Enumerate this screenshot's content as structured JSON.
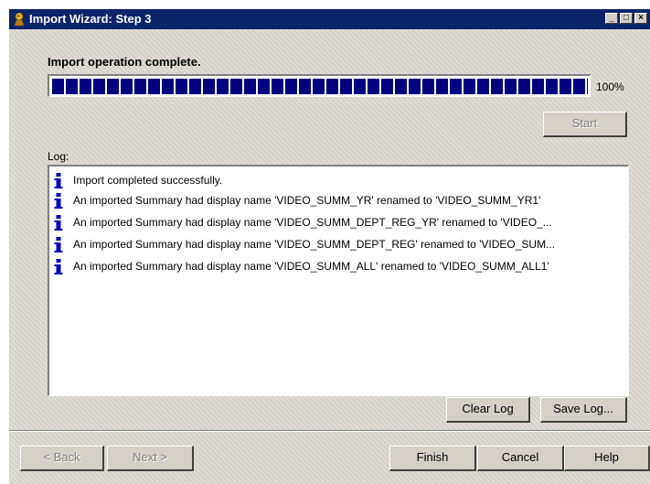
{
  "window": {
    "title": "Import Wizard: Step 3"
  },
  "titlebar": {
    "minimize": "_",
    "maximize": "□",
    "close": "×"
  },
  "progress": {
    "status": "Import operation complete.",
    "percent_label": "100%",
    "value": 1.0
  },
  "buttons": {
    "start": "Start",
    "clear_log": "Clear Log",
    "save_log": "Save Log...",
    "back": "< Back",
    "next": "Next >",
    "finish": "Finish",
    "cancel": "Cancel",
    "help": "Help"
  },
  "log": {
    "label": "Log:",
    "entries": [
      {
        "icon": "info-icon",
        "text": "Import completed successfully."
      },
      {
        "icon": "info-icon",
        "text": "An imported Summary had display name 'VIDEO_SUMM_YR' renamed to 'VIDEO_SUMM_YR1'"
      },
      {
        "icon": "info-icon",
        "text": "An imported Summary had display name 'VIDEO_SUMM_DEPT_REG_YR' renamed to 'VIDEO_..."
      },
      {
        "icon": "info-icon",
        "text": "An imported Summary had display name 'VIDEO_SUMM_DEPT_REG' renamed to 'VIDEO_SUM..."
      },
      {
        "icon": "info-icon",
        "text": "An imported Summary had display name 'VIDEO_SUMM_ALL' renamed to 'VIDEO_SUMM_ALL1'"
      }
    ]
  },
  "colors": {
    "titlebar": "#0a246a",
    "progress_fill": "#000080",
    "info_icon": "#0000cc",
    "face": "#d4d0c8"
  }
}
